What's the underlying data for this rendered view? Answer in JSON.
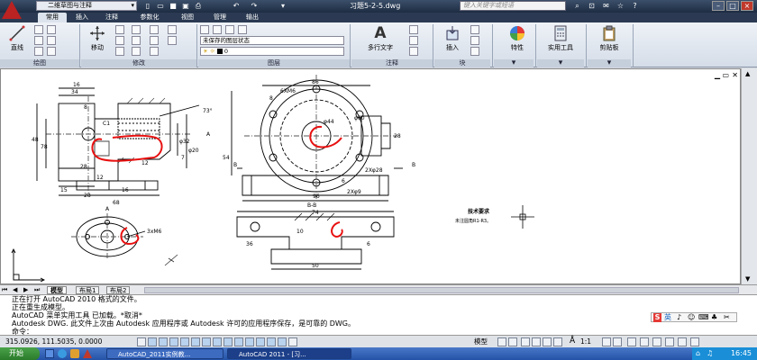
{
  "titlebar": {
    "workspace": "二维草图与注释",
    "document_title": "习题5-2-5.dwg",
    "search_placeholder": "键入关键字或短语"
  },
  "ribbon_tabs": [
    "常用",
    "插入",
    "注释",
    "参数化",
    "视图",
    "管理",
    "输出"
  ],
  "ribbon": {
    "draw": {
      "line_label": "直线",
      "panel_label": "绘图"
    },
    "modify": {
      "move_label": "移动",
      "panel_label": "修改"
    },
    "layers": {
      "state_value": "未保存的图层状态",
      "current_layer": "0",
      "panel_label": "图层"
    },
    "annotation": {
      "mtext_label": "多行文字",
      "panel_label": "注释"
    },
    "block": {
      "insert_label": "插入",
      "panel_label": "块"
    },
    "properties": {
      "label": "特性"
    },
    "utilities": {
      "label": "实用工具"
    },
    "clipboard": {
      "label": "剪贴板"
    }
  },
  "drawing": {
    "front_dims": [
      "16",
      "34",
      "48",
      "78",
      "28",
      "8",
      "C1",
      "73°",
      "12",
      "7",
      "A",
      "15",
      "12",
      "28",
      "16",
      "68",
      "φ32",
      "φ20"
    ],
    "top_dims": [
      "86",
      "6XM6",
      "8",
      "φ80",
      "φ44",
      "28",
      "96",
      "2Xφ28",
      "2Xφ9",
      "6",
      "54",
      "B",
      "B"
    ],
    "section_title": "B-B",
    "section_dims": [
      "74",
      "10",
      "36",
      "6",
      "50"
    ],
    "bottom_view_label": "A",
    "bottom_view_dim": "3xM6",
    "notes_title": "技术要求",
    "notes_line": "未注圆角R1-R3。"
  },
  "layout_tabs": [
    "模型",
    "布局1",
    "布局2"
  ],
  "command_lines": [
    "正在打开 AutoCAD 2010 格式的文件。",
    "正在重生成模型。",
    "AutoCAD 菜单实用工具 已加载。*取消*",
    "Autodesk DWG.   此文件上次由 Autodesk 应用程序或 Autodesk 许可的应用程序保存，是可靠的 DWG。",
    "命令："
  ],
  "ime": {
    "logo": "S",
    "mode": "英"
  },
  "status": {
    "coords": "315.0926, 111.5035, 0.0000",
    "model_label": "模型",
    "scale": "1:1"
  },
  "taskbar": {
    "start_label": "开始",
    "items": [
      "AutoCAD_2011实例教...",
      "AutoCAD 2011 - [习..."
    ],
    "clock": "16:45"
  },
  "colors": {
    "accent_red": "#e81010",
    "title_bg": "#1d2c42",
    "taskbar": "#2452a6"
  }
}
